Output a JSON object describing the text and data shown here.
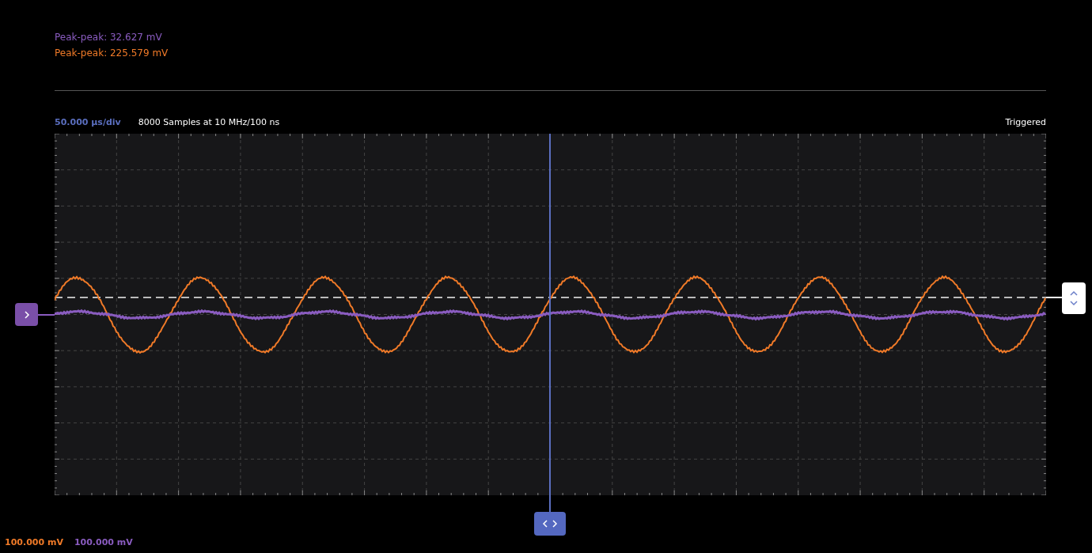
{
  "measurements": [
    {
      "label": "Peak-peak: 32.627 mV",
      "color": "#8a5cc0"
    },
    {
      "label": "Peak-peak: 225.579 mV",
      "color": "#f07a28"
    }
  ],
  "timebase": "50.000 µs/div",
  "samples": "8000 Samples at 10 MHz/100 ns",
  "status": "Triggered",
  "channel_scales": [
    {
      "label": "100.000 mV",
      "color": "#f07a28"
    },
    {
      "label": "100.000 mV",
      "color": "#8a5cc0"
    }
  ]
}
